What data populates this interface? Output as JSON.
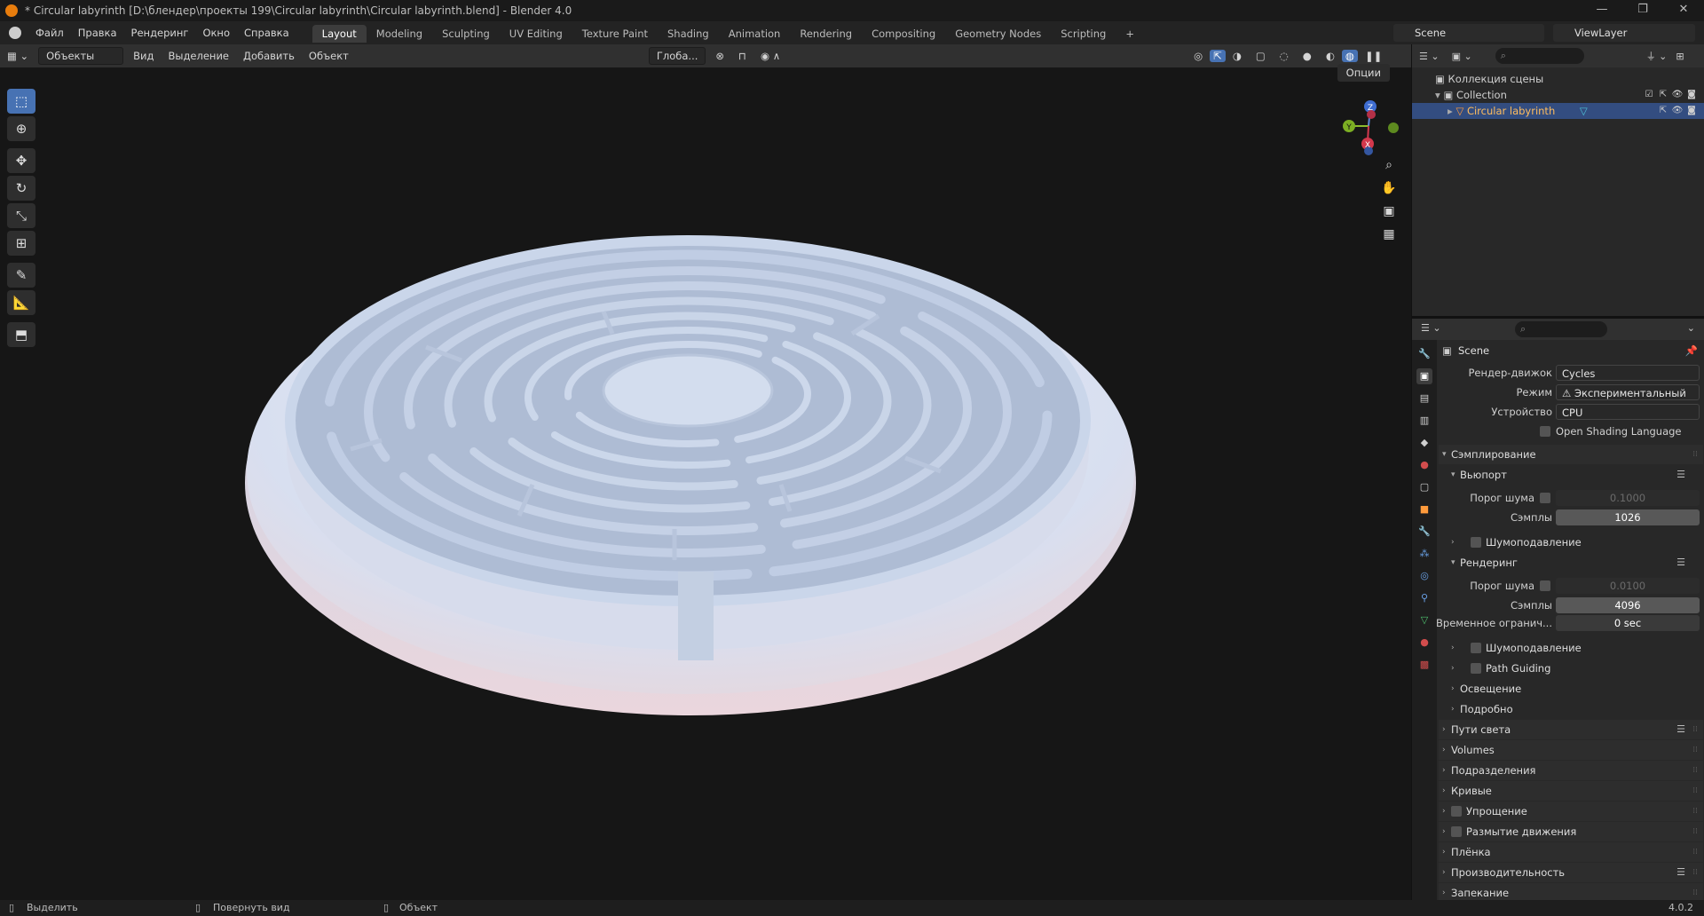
{
  "window": {
    "title": "* Circular labyrinth [D:\\блендер\\проекты 199\\Circular labyrinth\\Circular labyrinth.blend] - Blender 4.0",
    "minimize_glyph": "—",
    "maximize_glyph": "❐",
    "close_glyph": "✕"
  },
  "menu": [
    "Файл",
    "Правка",
    "Рендеринг",
    "Окно",
    "Справка"
  ],
  "workspaces": [
    "Layout",
    "Modeling",
    "Sculpting",
    "UV Editing",
    "Texture Paint",
    "Shading",
    "Animation",
    "Rendering",
    "Compositing",
    "Geometry Nodes",
    "Scripting"
  ],
  "add_workspace": "+",
  "scene_name": "Scene",
  "view_layer": "ViewLayer",
  "viewport_header": {
    "mode": "Объекты",
    "items": [
      "Вид",
      "Выделение",
      "Добавить",
      "Объект"
    ],
    "transform_orientation": "Глоба...",
    "options_label": "Опции"
  },
  "gizmo": {
    "x": "X",
    "y": "Y",
    "z": "Z"
  },
  "outliner": {
    "scene_collection": "Коллекция сцены",
    "collection": "Collection",
    "object": "Circular labyrinth"
  },
  "properties": {
    "context": "Scene",
    "render_engine_label": "Рендер-движок",
    "render_engine": "Cycles",
    "mode_label": "Режим",
    "mode_value": "Экспериментальный",
    "device_label": "Устройство",
    "device_value": "CPU",
    "osl_label": "Open Shading Language",
    "sampling": "Сэмплирование",
    "viewport": "Вьюпорт",
    "noise_threshold_label": "Порог шума",
    "viewport_noise_threshold": "0.1000",
    "samples_label": "Сэмплы",
    "viewport_samples": "1026",
    "denoise": "Шумоподавление",
    "render": "Рендеринг",
    "render_noise_threshold": "0.0100",
    "render_samples": "4096",
    "time_limit_label": "Временное огранич...",
    "time_limit_value": "0 sec",
    "path_guiding": "Path Guiding",
    "lights": "Освещение",
    "advanced": "Подробно",
    "light_paths": "Пути света",
    "volumes": "Volumes",
    "subdivision": "Подразделения",
    "curves": "Кривые",
    "simplify": "Упрощение",
    "motion_blur": "Размытие движения",
    "film": "Плёнка",
    "performance": "Производительность",
    "bake": "Запекание"
  },
  "statusbar": {
    "select": "Выделить",
    "rotate": "Повернуть вид",
    "object": "Объект",
    "version": "4.0.2"
  },
  "colors": {
    "accent": "#4772b3",
    "orange": "#e87d0d",
    "selected_text": "#ffbd5e",
    "maze": "#c7d6ec"
  }
}
